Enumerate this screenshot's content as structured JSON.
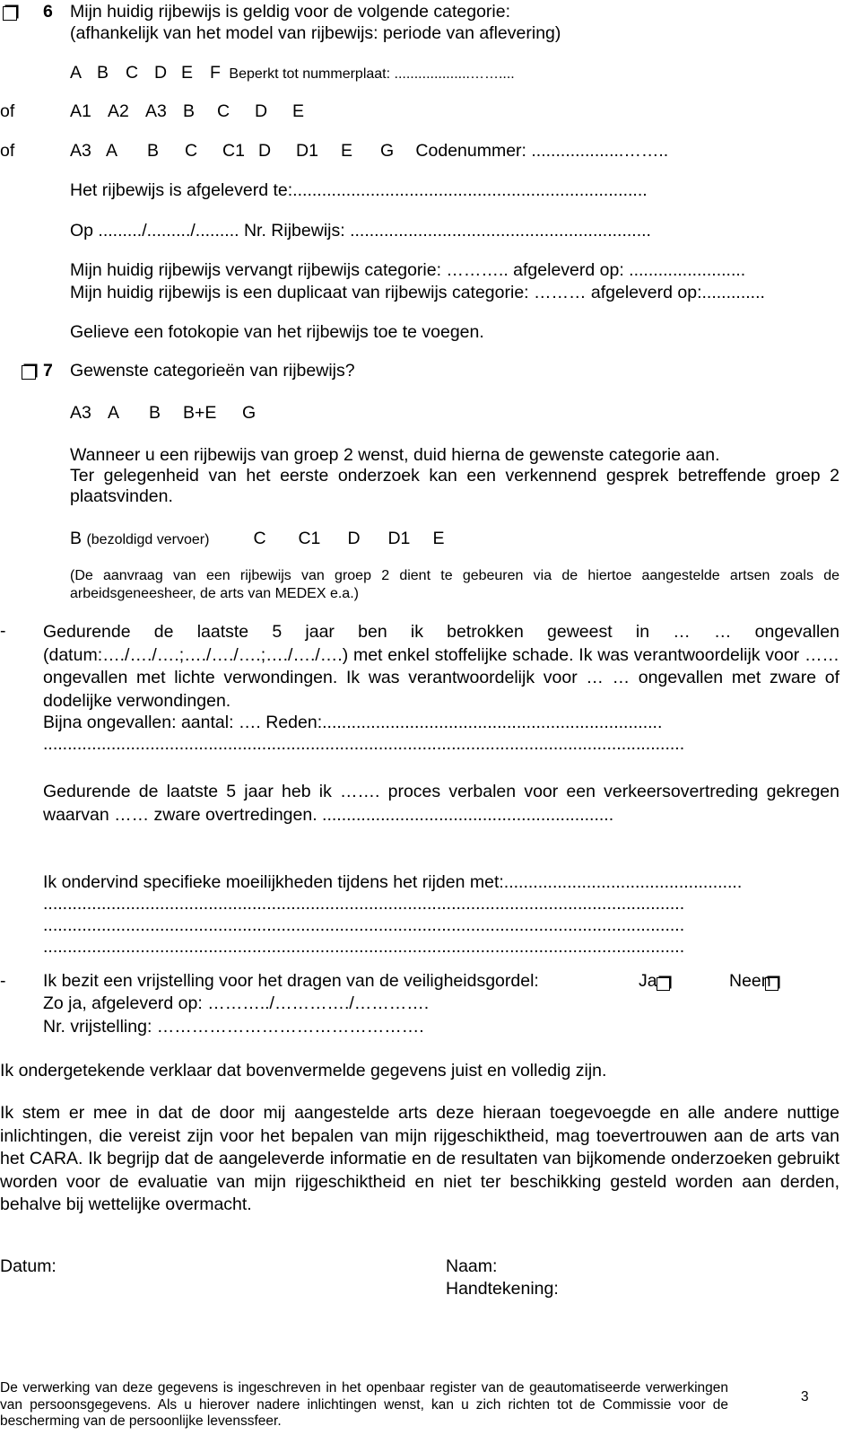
{
  "q6": {
    "number": "6",
    "title": "Mijn huidig rijbewijs is geldig voor de volgende categorie:",
    "subtitle": "(afhankelijk van het model van rijbewijs: periode van aflevering)",
    "row1": {
      "cats": [
        "A",
        "B",
        "C",
        "D",
        "E",
        "F"
      ],
      "extra": "Beperkt tot nummerplaat: ...................……...."
    },
    "row2": {
      "prefix": "of",
      "cats": [
        "A1",
        "A2",
        "A3",
        "B",
        "C",
        "D",
        "E"
      ]
    },
    "row3": {
      "prefix": "of",
      "cats": [
        "A3",
        "A",
        "B",
        "C",
        "C1",
        "D",
        "D1",
        "E",
        "G"
      ],
      "extra": "Codenummer: ...................…….."
    },
    "issued_at": "Het rijbewijs is afgeleverd te:.........................................................................",
    "date_nr": "Op ........./........./......... Nr. Rijbewijs: ..............................................................",
    "replaces": "Mijn huidig rijbewijs vervangt rijbewijs categorie: ……….. afgeleverd op: ........................",
    "duplicate": "Mijn huidig rijbewijs is een duplicaat van rijbewijs categorie: ……… afgeleverd op:.............",
    "photocopy": "Gelieve een fotokopie van het rijbewijs toe te voegen."
  },
  "q7": {
    "number": "7",
    "title": "Gewenste categorieën van rijbewijs?",
    "cats": [
      "A3",
      "A",
      "B",
      "B+E",
      "G"
    ],
    "group2_line1": "Wanneer u een rijbewijs van groep 2 wenst, duid hierna de gewenste categorie aan.",
    "group2_line2": "Ter gelegenheid van het eerste onderzoek kan een verkennend gesprek betreffende groep 2 plaatsvinden.",
    "group2_b": "B",
    "group2_b_note": "(bezoldigd vervoer)",
    "group2_cats": [
      "C",
      "C1",
      "D",
      "D1",
      "E"
    ],
    "note": "(De aanvraag van een rijbewijs van groep 2 dient te gebeuren via de hiertoe aangestelde artsen zoals de arbeidsgeneesheer, de arts van MEDEX e.a.)"
  },
  "accidents": {
    "bullet": "-",
    "text": "Gedurende de laatste 5 jaar ben ik betrokken geweest in … … ongevallen (datum:…./…./….;…./…./….;…./…./….) met enkel stoffelijke schade. Ik was verantwoordelijk voor …… ongevallen met lichte verwondingen. Ik was verantwoordelijk voor … … ongevallen met zware of dodelijke verwondingen.",
    "near_miss": "Bijna ongevallen: aantal: ….   Reden:......................................................................",
    "dots": "...................................................................................................................................."
  },
  "violations": {
    "text": "Gedurende de laatste 5 jaar heb ik ……. proces verbalen voor een verkeersovertreding gekregen waarvan …… zware overtredingen. ............................................................"
  },
  "difficulties": {
    "text": "Ik ondervind specifieke moeilijkheden tijdens het rijden met:.................................................",
    "dots": "...................................................................................................................................."
  },
  "seatbelt": {
    "bullet": "-",
    "question": "Ik bezit een vrijstelling voor het dragen van de veiligheidsgordel:",
    "yes": "Ja",
    "no": "Neen",
    "issued": "Zo ja, afgeleverd op: ………../…………./………….",
    "nr": "Nr. vrijstelling: ………………………………………."
  },
  "declaration": "Ik ondergetekende verklaar dat bovenvermelde gegevens juist en volledig zijn.",
  "consent": "Ik stem er mee in dat de door mij aangestelde arts deze hieraan toegevoegde en alle andere nuttige inlichtingen, die vereist zijn voor het bepalen van mijn rijgeschiktheid, mag toevertrouwen aan de arts van het CARA. Ik begrijp dat de aangeleverde informatie en de resultaten van bijkomende onderzoeken gebruikt worden voor de evaluatie van mijn rijgeschiktheid en niet ter beschikking gesteld worden aan derden, behalve bij wettelijke overmacht.",
  "signature": {
    "date_label": "Datum:",
    "name_label": "Naam:",
    "signature_label": "Handtekening:"
  },
  "footer": {
    "text": "De verwerking van deze gegevens is ingeschreven in het openbaar register van de geautomatiseerde verwerkingen van persoonsgegevens. Als u hierover nadere inlichtingen wenst, kan u zich richten tot de Commissie voor de bescherming van de persoonlijke levenssfeer.",
    "page_number": "3"
  }
}
